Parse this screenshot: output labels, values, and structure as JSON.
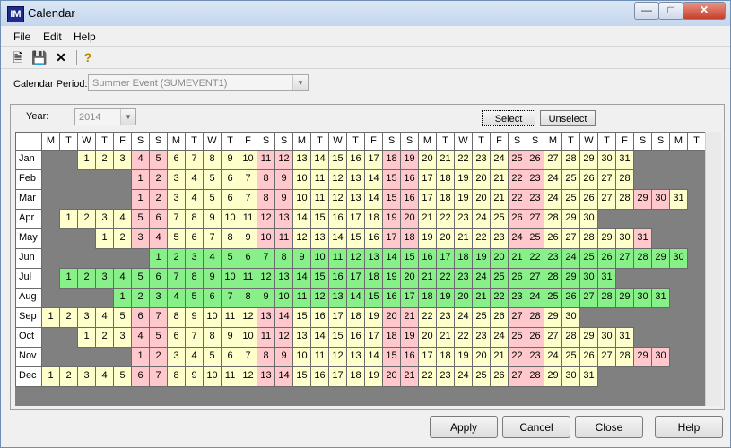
{
  "window": {
    "title": "Calendar",
    "app_icon_text": "IM"
  },
  "menu": {
    "file": "File",
    "edit": "Edit",
    "help": "Help"
  },
  "toolbar": {
    "new_icon": "new-document-icon",
    "save_icon": "save-icon",
    "delete_icon": "delete-x-icon",
    "help_icon": "help-question-icon"
  },
  "period": {
    "label": "Calendar Period:",
    "value": "Summer Event (SUMEVENT1)"
  },
  "year": {
    "label": "Year:",
    "value": "2014"
  },
  "select_buttons": {
    "select": "Select",
    "unselect": "Unselect"
  },
  "weekday_headers": [
    "M",
    "T",
    "W",
    "T",
    "F",
    "S",
    "S",
    "M",
    "T",
    "W",
    "T",
    "F",
    "S",
    "S",
    "M",
    "T",
    "W",
    "T",
    "F",
    "S",
    "S",
    "M",
    "T",
    "W",
    "T",
    "F",
    "S",
    "S",
    "M",
    "T",
    "W",
    "T",
    "F",
    "S",
    "S",
    "M",
    "T"
  ],
  "months": [
    {
      "name": "Jan",
      "offset": 2,
      "days": 31,
      "event": []
    },
    {
      "name": "Feb",
      "offset": 5,
      "days": 28,
      "event": []
    },
    {
      "name": "Mar",
      "offset": 5,
      "days": 31,
      "event": []
    },
    {
      "name": "Apr",
      "offset": 1,
      "days": 30,
      "event": []
    },
    {
      "name": "May",
      "offset": 3,
      "days": 31,
      "event": []
    },
    {
      "name": "Jun",
      "offset": 6,
      "days": 30,
      "event": [
        1,
        30
      ]
    },
    {
      "name": "Jul",
      "offset": 1,
      "days": 31,
      "event": [
        1,
        31
      ]
    },
    {
      "name": "Aug",
      "offset": 4,
      "days": 31,
      "event": [
        1,
        31
      ]
    },
    {
      "name": "Sep",
      "offset": 0,
      "days": 30,
      "event": []
    },
    {
      "name": "Oct",
      "offset": 2,
      "days": 31,
      "event": []
    },
    {
      "name": "Nov",
      "offset": 5,
      "days": 30,
      "event": []
    },
    {
      "name": "Dec",
      "offset": 0,
      "days": 31,
      "event": []
    }
  ],
  "colors": {
    "weekday": "#ffffcc",
    "weekend": "#ffc8cc",
    "event": "#88f088",
    "empty": "#808080"
  },
  "buttons": {
    "apply": "Apply",
    "cancel": "Cancel",
    "close": "Close",
    "help": "Help"
  }
}
